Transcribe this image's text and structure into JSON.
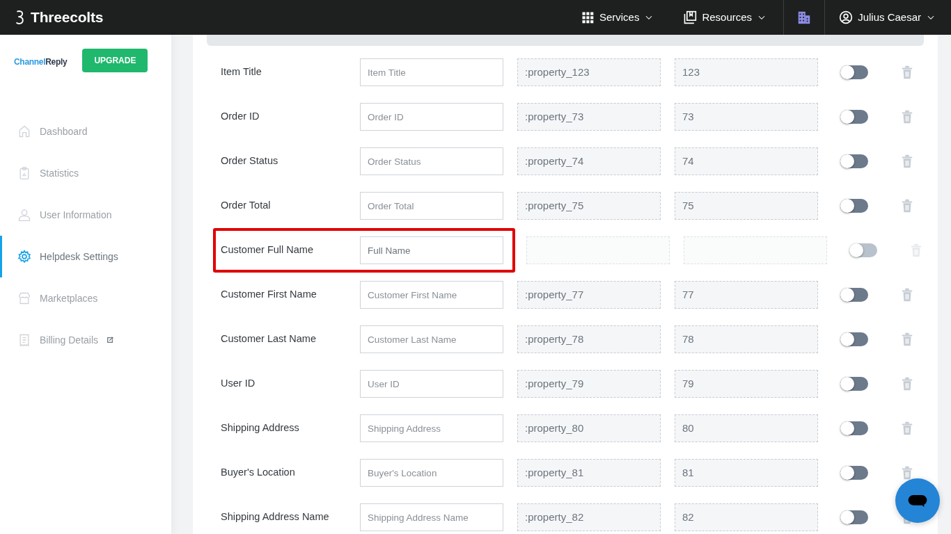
{
  "topbar": {
    "brand": "Threecolts",
    "menus": [
      {
        "label": "Services",
        "kind": "grid"
      },
      {
        "label": "Resources",
        "kind": "book"
      }
    ],
    "user": "Julius Caesar"
  },
  "sidebar": {
    "logo": {
      "part1": "Channel",
      "part2": "Reply"
    },
    "upgrade": "UPGRADE",
    "items": [
      {
        "label": "Dashboard",
        "kind": "home",
        "selected": false,
        "external": false
      },
      {
        "label": "Statistics",
        "kind": "clipboard",
        "selected": false,
        "external": false
      },
      {
        "label": "User Information",
        "kind": "user",
        "selected": false,
        "external": false
      },
      {
        "label": "Helpdesk Settings",
        "kind": "gear",
        "selected": true,
        "external": false
      },
      {
        "label": "Marketplaces",
        "kind": "store",
        "selected": false,
        "external": false
      },
      {
        "label": "Billing Details",
        "kind": "bill",
        "selected": false,
        "external": true
      }
    ]
  },
  "rows": [
    {
      "label": "Item Title",
      "placeholder": "Item Title",
      "property": ":property_123",
      "id": "123",
      "on": false,
      "disabled": false,
      "highlighted": false
    },
    {
      "label": "Order ID",
      "placeholder": "Order ID",
      "property": ":property_73",
      "id": "73",
      "on": false,
      "disabled": false,
      "highlighted": false
    },
    {
      "label": "Order Status",
      "placeholder": "Order Status",
      "property": ":property_74",
      "id": "74",
      "on": false,
      "disabled": false,
      "highlighted": false
    },
    {
      "label": "Order Total",
      "placeholder": "Order Total",
      "property": ":property_75",
      "id": "75",
      "on": false,
      "disabled": false,
      "highlighted": false
    },
    {
      "label": "Customer Full Name",
      "value": "Full Name",
      "on": false,
      "disabled": true,
      "highlighted": true
    },
    {
      "label": "Customer First Name",
      "placeholder": "Customer First Name",
      "property": ":property_77",
      "id": "77",
      "on": false,
      "disabled": false,
      "highlighted": false
    },
    {
      "label": "Customer Last Name",
      "placeholder": "Customer Last Name",
      "property": ":property_78",
      "id": "78",
      "on": false,
      "disabled": false,
      "highlighted": false
    },
    {
      "label": "User ID",
      "placeholder": "User ID",
      "property": ":property_79",
      "id": "79",
      "on": false,
      "disabled": false,
      "highlighted": false
    },
    {
      "label": "Shipping Address",
      "placeholder": "Shipping Address",
      "property": ":property_80",
      "id": "80",
      "on": false,
      "disabled": false,
      "highlighted": false
    },
    {
      "label": "Buyer's Location",
      "placeholder": "Buyer's Location",
      "property": ":property_81",
      "id": "81",
      "on": false,
      "disabled": false,
      "highlighted": false
    },
    {
      "label": "Shipping Address Name",
      "placeholder": "Shipping Address Name",
      "property": ":property_82",
      "id": "82",
      "on": false,
      "disabled": false,
      "highlighted": false
    }
  ]
}
